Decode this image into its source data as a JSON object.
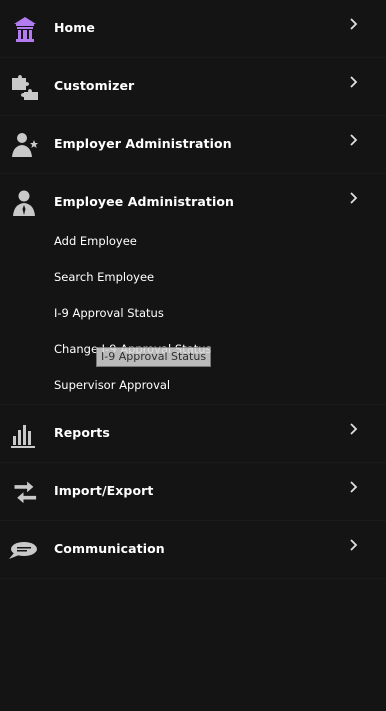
{
  "menu": {
    "items": [
      {
        "label": "Home",
        "icon": "home-icon",
        "icon_color": "#b27cf0"
      },
      {
        "label": "Customizer",
        "icon": "puzzle-icon",
        "icon_color": "#c9c9c9"
      },
      {
        "label": "Employer Administration",
        "icon": "employer-star-icon",
        "icon_color": "#c9c9c9"
      },
      {
        "label": "Employee Administration",
        "icon": "employee-icon",
        "icon_color": "#c9c9c9",
        "expanded": true,
        "subitems": [
          {
            "label": "Add Employee"
          },
          {
            "label": "Search Employee"
          },
          {
            "label": "I-9 Approval Status"
          },
          {
            "label": "Change I-9 Approval Status"
          },
          {
            "label": "Supervisor Approval"
          }
        ]
      },
      {
        "label": "Reports",
        "icon": "bar-chart-icon",
        "icon_color": "#c9c9c9"
      },
      {
        "label": "Import/Export",
        "icon": "swap-arrows-icon",
        "icon_color": "#c9c9c9"
      },
      {
        "label": "Communication",
        "icon": "speech-bubble-icon",
        "icon_color": "#c9c9c9"
      }
    ]
  },
  "tooltip": {
    "text": "I-9 Approval Status"
  }
}
